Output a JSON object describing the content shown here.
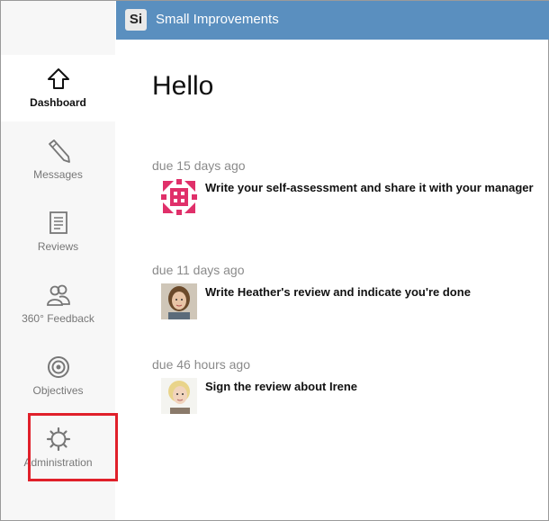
{
  "app": {
    "logo_text": "Si",
    "title": "Small Improvements"
  },
  "sidebar": {
    "items": [
      {
        "label": "Dashboard",
        "icon": "home-icon",
        "active": true
      },
      {
        "label": "Messages",
        "icon": "pencil-icon"
      },
      {
        "label": "Reviews",
        "icon": "document-icon"
      },
      {
        "label": "360° Feedback",
        "icon": "people-icon"
      },
      {
        "label": "Objectives",
        "icon": "target-icon"
      },
      {
        "label": "Administration",
        "icon": "gear-icon",
        "highlighted": true
      }
    ]
  },
  "main": {
    "greeting": "Hello",
    "tasks": [
      {
        "due": "due 15 days ago",
        "text": "Write your self-assessment and share it with your manager",
        "avatar": "pink-pattern-avatar"
      },
      {
        "due": "due 11 days ago",
        "text": "Write Heather's review and indicate you're done",
        "avatar": "person-avatar"
      },
      {
        "due": "due 46 hours ago",
        "text": "Sign the review about Irene",
        "avatar": "person-avatar"
      }
    ]
  },
  "colors": {
    "topbar": "#5a8fbf",
    "highlight": "#e0202a",
    "sidebar": "#f7f7f7"
  }
}
